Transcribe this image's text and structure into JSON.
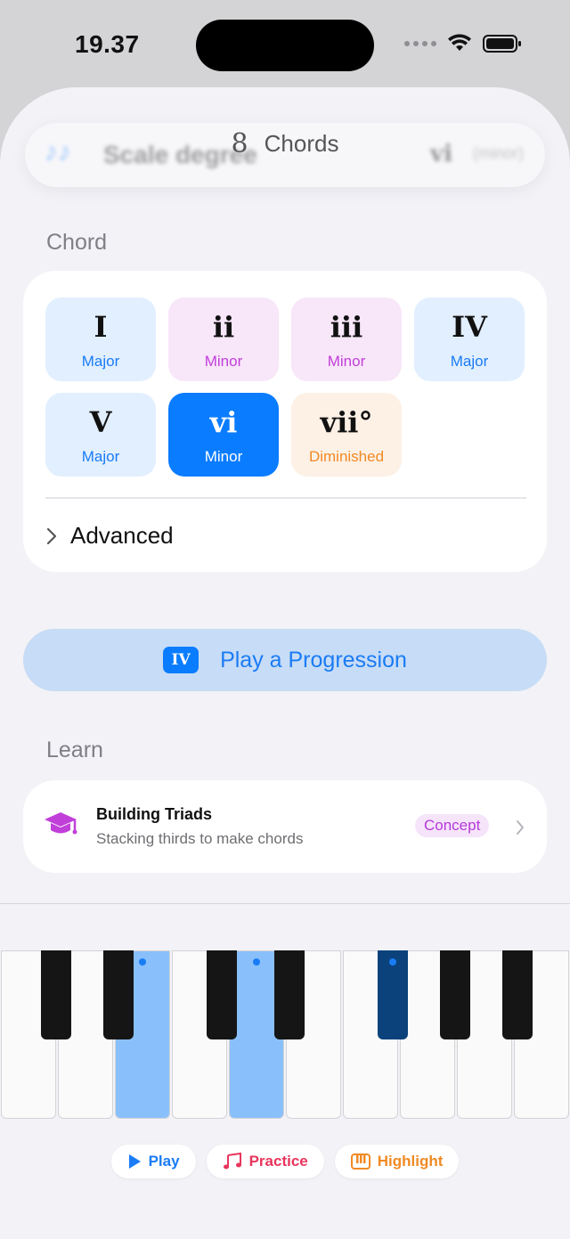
{
  "status_bar": {
    "time": "19.37"
  },
  "header": {
    "title": "Chords",
    "title_glyph": "8",
    "blurred": {
      "label": "Scale degree",
      "numeral": "vi",
      "quality": "(minor)"
    }
  },
  "chord_section": {
    "label": "Chord",
    "chords": [
      {
        "numeral": "I",
        "quality": "Major",
        "kind": "major",
        "selected": false
      },
      {
        "numeral": "ii",
        "quality": "Minor",
        "kind": "minor",
        "selected": false
      },
      {
        "numeral": "iii",
        "quality": "Minor",
        "kind": "minor",
        "selected": false
      },
      {
        "numeral": "IV",
        "quality": "Major",
        "kind": "major",
        "selected": false
      },
      {
        "numeral": "V",
        "quality": "Major",
        "kind": "major",
        "selected": false
      },
      {
        "numeral": "vi",
        "quality": "Minor",
        "kind": "minor",
        "selected": true
      },
      {
        "numeral": "vii°",
        "quality": "Diminished",
        "kind": "diminished",
        "selected": false
      }
    ],
    "advanced_label": "Advanced"
  },
  "progression_button": {
    "badge": "IV",
    "label": "Play a Progression"
  },
  "learn_section": {
    "label": "Learn",
    "item": {
      "title": "Building Triads",
      "subtitle": "Stacking thirds to make chords",
      "badge": "Concept"
    }
  },
  "piano": {
    "highlighted_white_keys": [
      2,
      4
    ],
    "highlighted_black_keys": [
      4
    ],
    "dotted_white_keys": [
      2,
      4
    ]
  },
  "actions": [
    {
      "label": "Play",
      "icon": "play-icon",
      "color": "#1a7cf5"
    },
    {
      "label": "Practice",
      "icon": "music-notes-icon",
      "color": "#e8355d"
    },
    {
      "label": "Highlight",
      "icon": "piano-keys-icon",
      "color": "#f08a24"
    }
  ],
  "colors": {
    "accent": "#0a7cff",
    "major_bg": "#e2efff",
    "major_fg": "#1a7cf5",
    "minor_bg": "#f8e6f9",
    "minor_fg": "#c13fd9",
    "diminished_bg": "#fdf1e6",
    "diminished_fg": "#f08a24"
  }
}
